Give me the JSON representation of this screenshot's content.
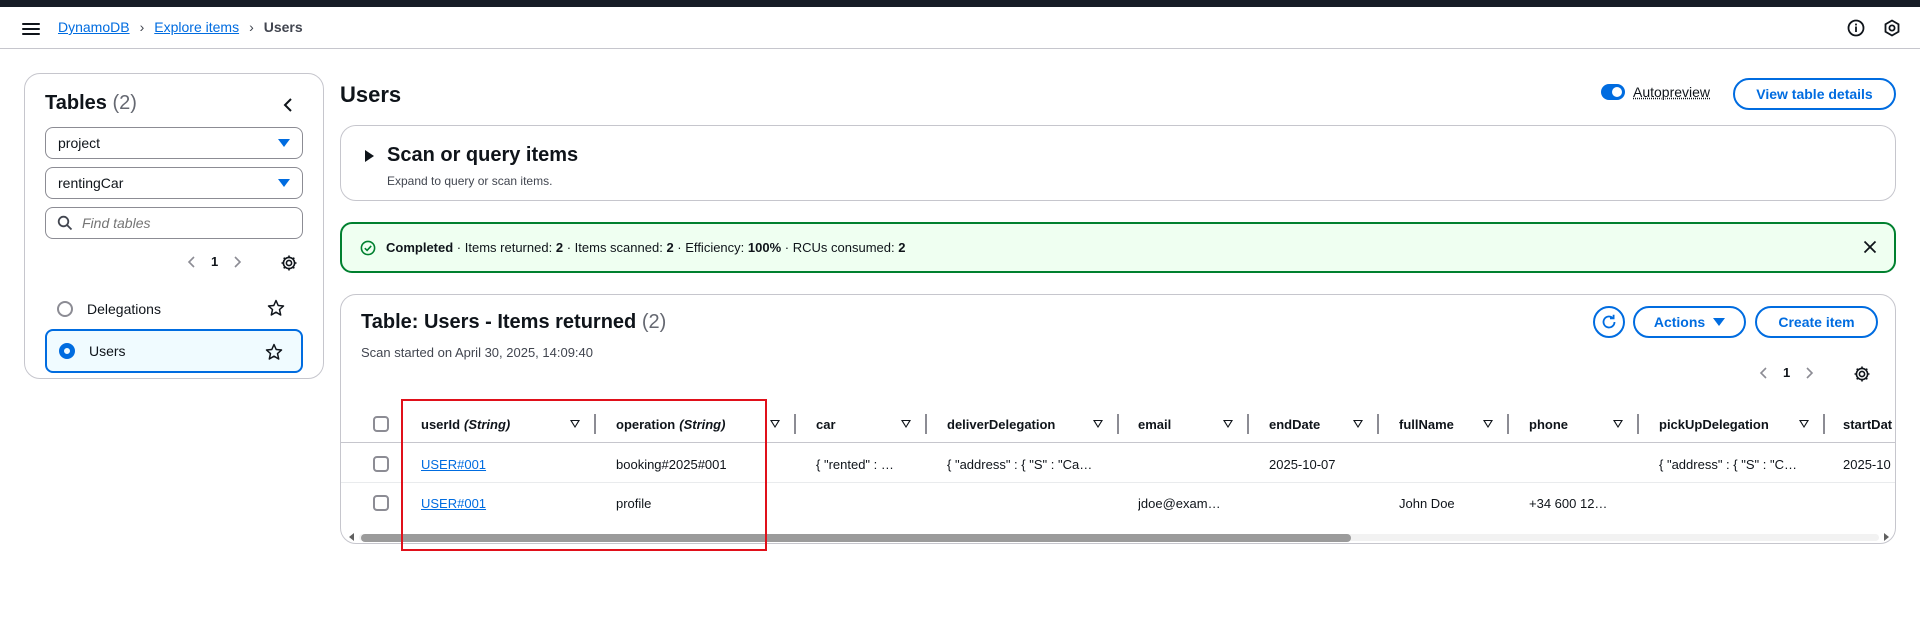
{
  "breadcrumbs": [
    "DynamoDB",
    "Explore items",
    "Users"
  ],
  "sidebar": {
    "title": "Tables",
    "count": "(2)",
    "filters": [
      "project",
      "rentingCar"
    ],
    "search_placeholder": "Find tables",
    "page": "1",
    "tables": [
      {
        "name": "Delegations",
        "selected": false
      },
      {
        "name": "Users",
        "selected": true
      }
    ]
  },
  "header": {
    "title": "Users",
    "autopreview_label": "Autopreview",
    "view_details_label": "View table details"
  },
  "scan": {
    "title": "Scan or query items",
    "subtitle": "Expand to query or scan items."
  },
  "alert": {
    "status": "Completed",
    "returned_label": "Items returned:",
    "returned": "2",
    "scanned_label": "Items scanned:",
    "scanned": "2",
    "efficiency_label": "Efficiency:",
    "efficiency": "100%",
    "rcu_label": "RCUs consumed:",
    "rcu": "2",
    "sep": "·"
  },
  "results": {
    "title": "Table: Users - Items returned",
    "count": "(2)",
    "scan_started": "Scan started on April 30, 2025, 14:09:40",
    "actions_label": "Actions",
    "create_label": "Create item",
    "page": "1",
    "columns": [
      {
        "name": "userId",
        "type": "(String)"
      },
      {
        "name": "operation",
        "type": "(String)"
      },
      {
        "name": "car",
        "type": ""
      },
      {
        "name": "deliverDelegation",
        "type": ""
      },
      {
        "name": "email",
        "type": ""
      },
      {
        "name": "endDate",
        "type": ""
      },
      {
        "name": "fullName",
        "type": ""
      },
      {
        "name": "phone",
        "type": ""
      },
      {
        "name": "pickUpDelegation",
        "type": ""
      },
      {
        "name": "startDat",
        "type": ""
      }
    ],
    "rows": [
      [
        "USER#001",
        "booking#2025#001",
        "{ \"rented\" : …",
        "{ \"address\" : { \"S\" : \"Ca…",
        "",
        "2025-10-07",
        "",
        "",
        "{ \"address\" : { \"S\" : \"C…",
        "2025-10"
      ],
      [
        "USER#001",
        "profile",
        "",
        "",
        "jdoe@exam…",
        "",
        "John Doe",
        "+34 600 12…",
        "",
        ""
      ]
    ]
  }
}
